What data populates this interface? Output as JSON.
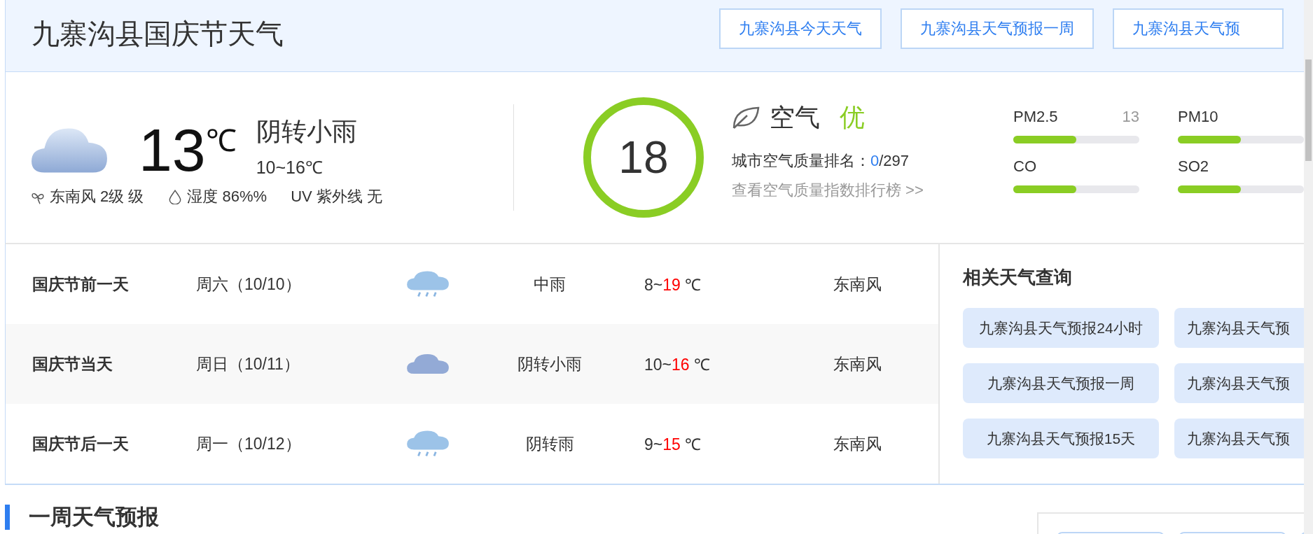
{
  "header": {
    "title": "九寨沟县国庆节天气",
    "links": [
      "九寨沟县今天天气",
      "九寨沟县天气预报一周",
      "九寨沟县天气预"
    ]
  },
  "current": {
    "kind": "cloudy",
    "temp": "13",
    "unit": "℃",
    "desc": "阴转小雨",
    "range": "10~16℃",
    "wind": "东南风 2级 级",
    "humidity": "湿度 86%%",
    "uv": "UV 紫外线 无"
  },
  "air": {
    "aqi": "18",
    "label": "空气",
    "quality": "优",
    "rank_label": "城市空气质量排名：",
    "rank": "0",
    "rank_total": "/297",
    "link": "查看空气质量指数排行榜 >>",
    "pollutants": [
      {
        "name": "PM2.5",
        "value": "13",
        "level": 0.5
      },
      {
        "name": "PM10",
        "level": 0.5
      },
      {
        "name": "CO",
        "level": 0.5
      },
      {
        "name": "SO2",
        "level": 0.5
      }
    ]
  },
  "days": [
    {
      "name": "国庆节前一天",
      "date": "周六（10/10）",
      "kind": "rain",
      "weather": "中雨",
      "low": "8~",
      "high": "19",
      "unit": " ℃",
      "wind": "东南风"
    },
    {
      "name": "国庆节当天",
      "date": "周日（10/11）",
      "kind": "cloudy",
      "weather": "阴转小雨",
      "low": "10~",
      "high": "16",
      "unit": " ℃",
      "wind": "东南风"
    },
    {
      "name": "国庆节后一天",
      "date": "周一（10/12）",
      "kind": "rain",
      "weather": "阴转雨",
      "low": "9~",
      "high": "15",
      "unit": " ℃",
      "wind": "东南风"
    }
  ],
  "related": {
    "title": "相关天气查询",
    "links": [
      "九寨沟县天气预报24小时",
      "九寨沟县天气预",
      "九寨沟县天气预报一周",
      "九寨沟县天气预",
      "九寨沟县天气预报15天",
      "九寨沟县天气预"
    ]
  },
  "week": {
    "title": "一周天气预报"
  }
}
